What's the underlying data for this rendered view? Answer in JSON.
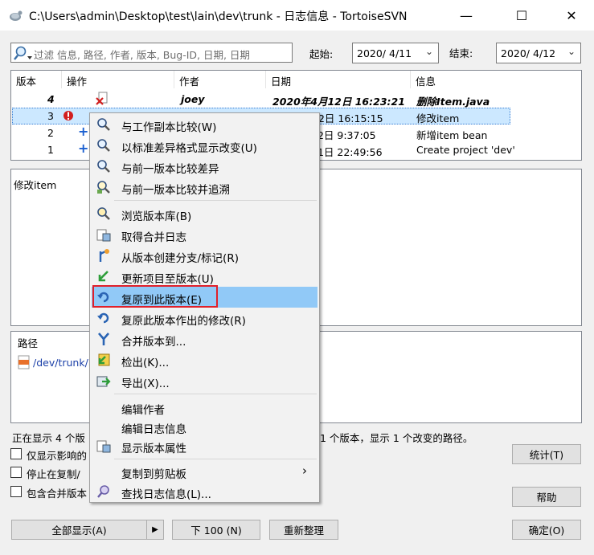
{
  "window": {
    "title": "C:\\Users\\admin\\Desktop\\test\\lain\\dev\\trunk - 日志信息 - TortoiseSVN",
    "minimize": "—",
    "maximize": "☐",
    "close": "✕"
  },
  "filter": {
    "placeholder": "过滤 信息, 路径, 作者, 版本, Bug-ID, 日期, 日期",
    "from_label": "起始:",
    "from_value": "2020/  4/11",
    "to_label": "结束:",
    "to_value": "2020/  4/12"
  },
  "log": {
    "columns": [
      "版本",
      "操作",
      "作者",
      "日期",
      "信息"
    ],
    "rows": [
      {
        "rev": "4",
        "author": "joey",
        "date": "2020年4月12日 16:23:21",
        "msg": "删除Item.java"
      },
      {
        "rev": "3",
        "author": "",
        "date": "12日 16:15:15",
        "msg": "修改item"
      },
      {
        "rev": "2",
        "author": "",
        "date": "12日 9:37:05",
        "msg": "新增item bean"
      },
      {
        "rev": "1",
        "author": "",
        "date": "11日 22:49:56",
        "msg": "Create project 'dev'"
      }
    ]
  },
  "message": {
    "text": "修改item"
  },
  "paths": {
    "header": "路径",
    "item": "/dev/trunk/It"
  },
  "status": {
    "left": "正在显示 4 个版",
    "right": "1 个版本，显示 1 个改变的路径。"
  },
  "options": [
    {
      "label": "仅显示影响的"
    },
    {
      "label": "停止在复制/"
    },
    {
      "label": "包含合并版本"
    }
  ],
  "buttons": {
    "stats": "统计(T)",
    "help": "帮助",
    "ok": "确定(O)",
    "show_all": "全部显示(A)",
    "next100": "下 100 (N)",
    "refresh": "重新整理"
  },
  "menu": {
    "items": [
      {
        "label": "与工作副本比较(W)",
        "icon": "diff-magnifier-icon"
      },
      {
        "label": "以标准差异格式显示改变(U)",
        "icon": "unified-diff-icon"
      },
      {
        "label": "与前一版本比较差异",
        "icon": "compare-previous-icon"
      },
      {
        "label": "与前一版本比较并追溯",
        "icon": "blame-icon"
      },
      {
        "label": "浏览版本库(B)",
        "icon": "repo-browser-icon"
      },
      {
        "label": "取得合并日志",
        "icon": "merge-log-icon"
      },
      {
        "label": "从版本创建分支/标记(R)",
        "icon": "branch-icon"
      },
      {
        "label": "更新项目至版本(U)",
        "icon": "update-icon"
      },
      {
        "label": "复原到此版本(E)",
        "icon": "revert-icon"
      },
      {
        "label": "复原此版本作出的修改(R)",
        "icon": "revert-changes-icon"
      },
      {
        "label": "合并版本到...",
        "icon": "merge-icon"
      },
      {
        "label": "检出(K)...",
        "icon": "checkout-icon"
      },
      {
        "label": "导出(X)...",
        "icon": "export-icon"
      },
      {
        "label": "编辑作者",
        "icon": ""
      },
      {
        "label": "编辑日志信息",
        "icon": ""
      },
      {
        "label": "显示版本属性",
        "icon": "properties-icon"
      },
      {
        "label": "复制到剪贴板",
        "icon": ""
      },
      {
        "label": "查找日志信息(L)...",
        "icon": "find-icon"
      }
    ],
    "submenu_arrow": "›"
  },
  "colors": {
    "highlight": "#91c9f7",
    "selection": "#cce8ff",
    "annotation_box": "#e0202a"
  }
}
